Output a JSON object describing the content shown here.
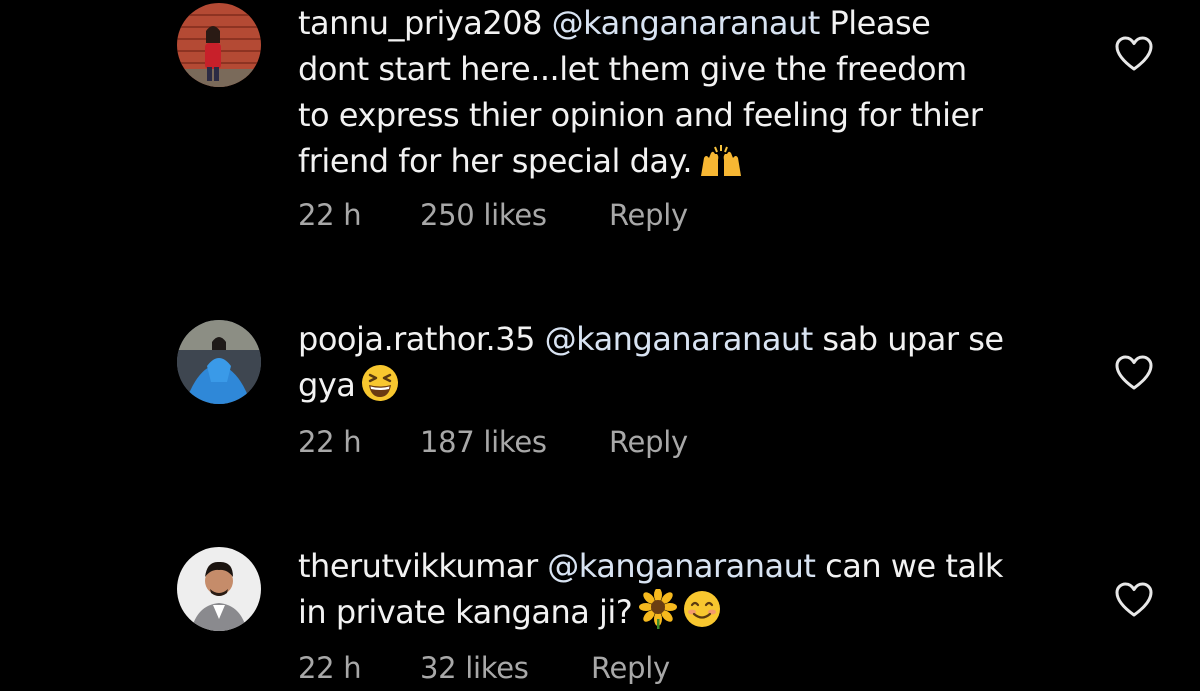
{
  "comments": [
    {
      "username": "tannu_priya208",
      "mention": "@kanganaranaut",
      "line1_rest": "Please",
      "lines": [
        "dont start here...let them give the freedom",
        "to express thier opinion and feeling for thier",
        "friend for her special day."
      ],
      "emoji": "raising-hands-emoji",
      "time": "22 h",
      "likes": "250 likes",
      "reply": "Reply"
    },
    {
      "username": "pooja.rathor.35",
      "mention": "@kanganaranaut",
      "line1_rest": "sab upar se",
      "lines": [
        "gya"
      ],
      "emoji": "grinning-squinting-emoji",
      "time": "22 h",
      "likes": "187 likes",
      "reply": "Reply"
    },
    {
      "username": "therutvikkumar",
      "mention": "@kanganaranaut",
      "line1_rest": "can we talk",
      "lines": [
        "in private kangana ji?"
      ],
      "emoji": "sunflower-smiling-emoji",
      "time": "22 h",
      "likes": "32 likes",
      "reply": "Reply"
    }
  ],
  "icons": {
    "like": "heart-outline-icon"
  },
  "colors": {
    "background": "#000000",
    "text": "#f2f2f2",
    "meta": "#a8a8a8"
  }
}
